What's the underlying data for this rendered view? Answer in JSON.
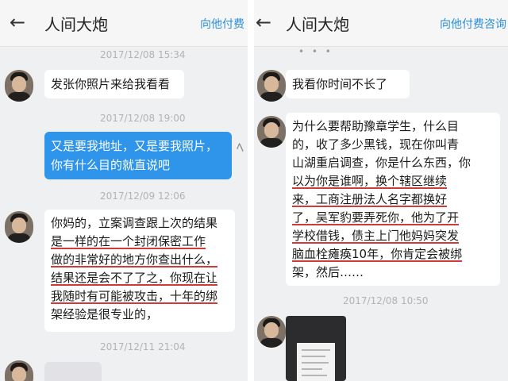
{
  "left": {
    "header": {
      "back_icon": "←",
      "title": "人间大炮",
      "link": "向他付费"
    },
    "messages": [
      {
        "timestamp": "2017/12/08 15:34",
        "text": "发张你照片来给我看看"
      },
      {
        "timestamp": "2017/12/08 19:00",
        "lines": [
          "又是要我地址，又是要我照片，",
          "你有什么目的就直说吧"
        ]
      },
      {
        "timestamp": "2017/12/09 12:06",
        "lines": [
          "你妈的，立案调查跟上次的结果",
          "是一样的在一个封闭保密工作",
          "做的非常好的地方你查出什么，",
          "结果还是会不了了之，你现在让",
          "我随时有可能被攻击，十年的绑",
          "架经验是很专业的，"
        ]
      },
      {
        "timestamp": "2017/12/11 21:04"
      }
    ]
  },
  "right": {
    "header": {
      "back_icon": "←",
      "title": "人间大炮",
      "link": "向他付费咨询"
    },
    "top_dots": "• • •",
    "messages": [
      {
        "text": "我看你时间不长了"
      },
      {
        "lines": [
          "为什么要帮助豫章学生，什么目",
          "的，收了多少黑钱，现在你叫青",
          "山湖重启调查，你是什么东西，你",
          "以为你是谁啊，换个辖区继续",
          "来，工商注册法人名字都换好",
          "了，吴军豹要弄死你，他为了开",
          "学校借钱，债主上门他妈妈突发",
          "脑血栓瘫痪10年，你肯定会被绑",
          "架，然后……"
        ]
      },
      {
        "timestamp": "2017/12/08 10:50"
      }
    ]
  },
  "colors": {
    "accent": "#2f95ea",
    "underline": "#d13a3a",
    "background": "#eff0f2"
  }
}
